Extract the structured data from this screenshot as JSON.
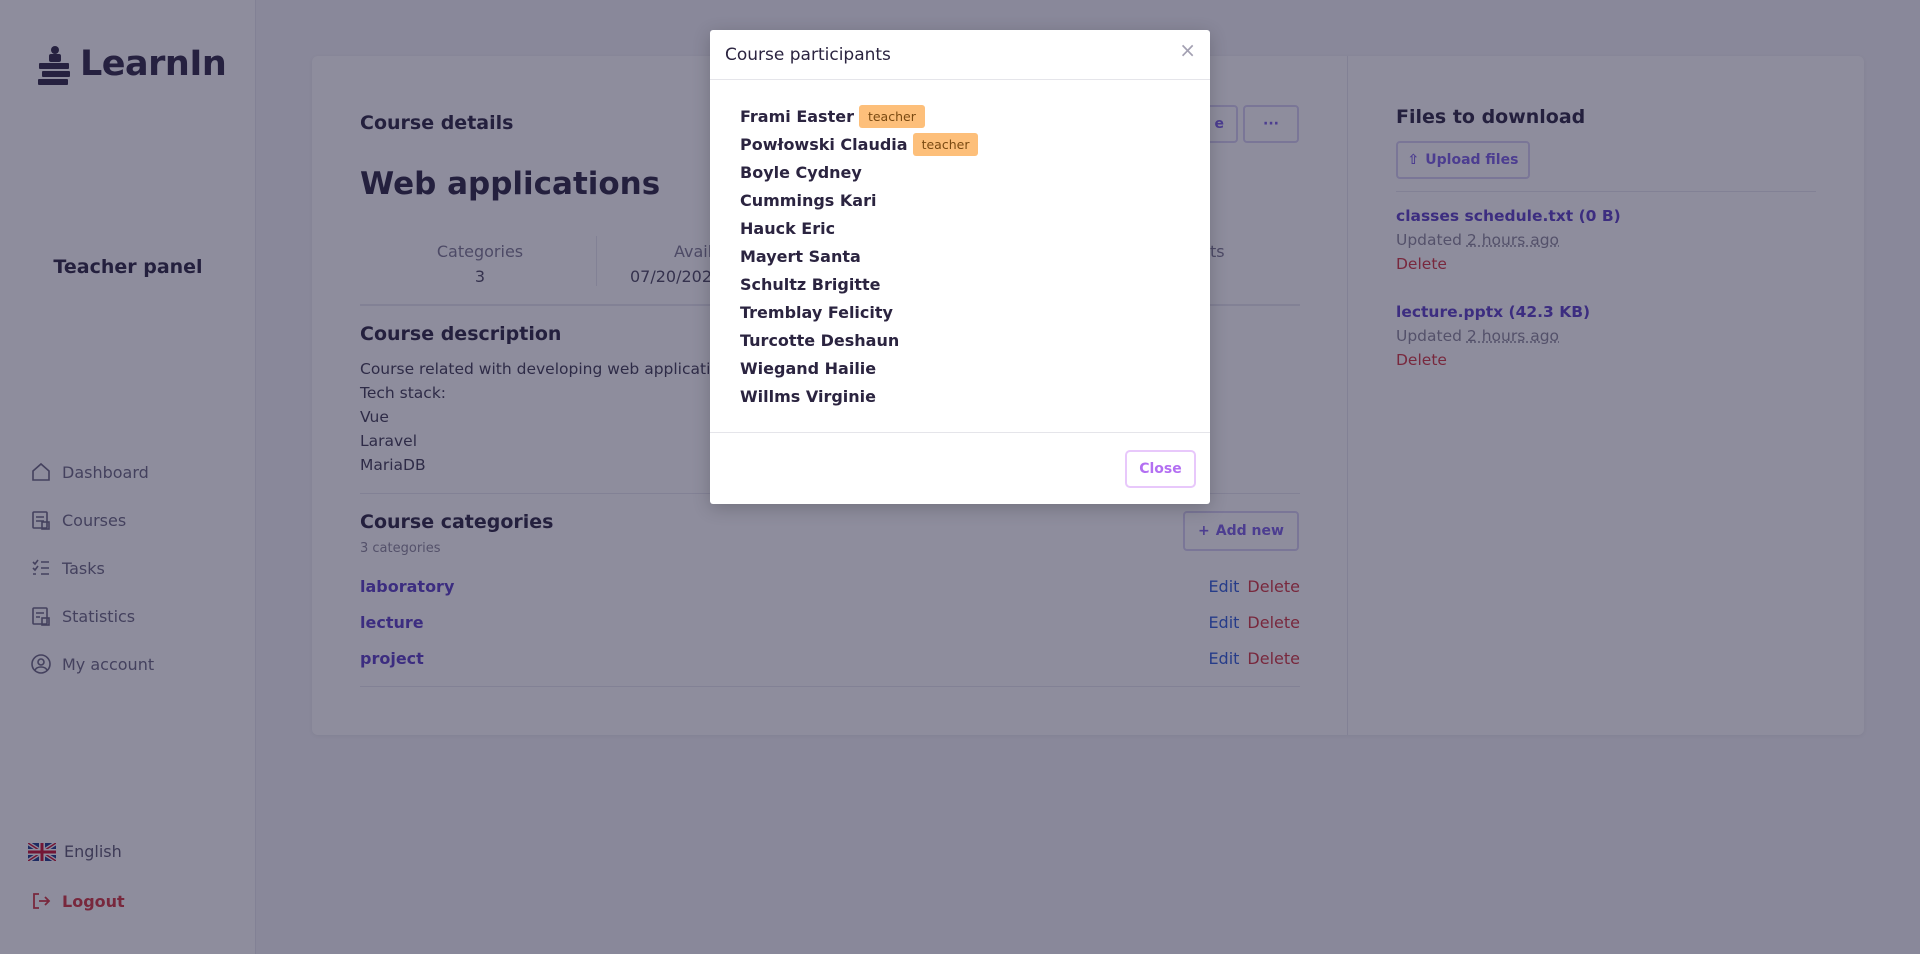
{
  "app": {
    "name": "LearnIn"
  },
  "sidebar": {
    "panel_title": "Teacher panel",
    "items": [
      {
        "label": "Dashboard",
        "icon": "home-icon"
      },
      {
        "label": "Courses",
        "icon": "courses-icon"
      },
      {
        "label": "Tasks",
        "icon": "tasks-icon"
      },
      {
        "label": "Statistics",
        "icon": "statistics-icon"
      },
      {
        "label": "My account",
        "icon": "user-circle-icon"
      }
    ],
    "language": "English",
    "logout": "Logout"
  },
  "course": {
    "section_title": "Course details",
    "title": "Web applications",
    "stats": [
      {
        "label": "Categories",
        "value": "3"
      },
      {
        "label": "Availa",
        "value": "07/20/202"
      },
      {
        "label": "ts",
        "value": ""
      }
    ],
    "edit_partial": "e",
    "more_label": "···",
    "description_title": "Course description",
    "description_lines": [
      "Course related with developing web applications",
      "Tech stack:",
      "Vue",
      "Laravel",
      "MariaDB"
    ],
    "categories_title": "Course categories",
    "categories_count": "3 categories",
    "add_new": "Add new",
    "edit_label": "Edit",
    "delete_label": "Delete",
    "categories": [
      "laboratory",
      "lecture",
      "project"
    ]
  },
  "files": {
    "title": "Files to download",
    "upload": "Upload files",
    "updated_prefix": "Updated",
    "delete_label": "Delete",
    "items": [
      {
        "name": "classes schedule.txt (0 B)",
        "updated": "2 hours ago"
      },
      {
        "name": "lecture.pptx (42.3 KB)",
        "updated": "2 hours ago"
      }
    ]
  },
  "modal": {
    "title": "Course participants",
    "close_x": "×",
    "close_button": "Close",
    "participants": [
      {
        "name": "Frami Easter",
        "badge": "teacher"
      },
      {
        "name": "Powłowski Claudia",
        "badge": "teacher"
      },
      {
        "name": "Boyle Cydney"
      },
      {
        "name": "Cummings Kari"
      },
      {
        "name": "Hauck Eric"
      },
      {
        "name": "Mayert Santa"
      },
      {
        "name": "Schultz Brigitte"
      },
      {
        "name": "Tremblay Felicity"
      },
      {
        "name": "Turcotte Deshaun"
      },
      {
        "name": "Wiegand Hailie"
      },
      {
        "name": "Willms Virginie"
      }
    ]
  },
  "colors": {
    "accent": "#7b5fe4",
    "link": "#5b3fc4",
    "danger": "#d3343f",
    "badge": "#fdbf7a"
  }
}
